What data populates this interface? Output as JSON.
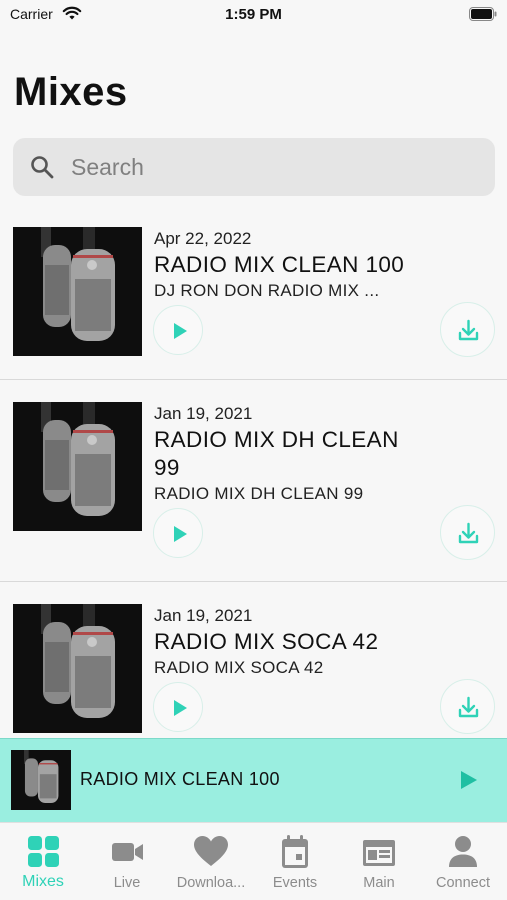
{
  "status_bar": {
    "carrier": "Carrier",
    "time": "1:59 PM"
  },
  "page": {
    "title": "Mixes"
  },
  "search": {
    "placeholder": "Search"
  },
  "mixes": [
    {
      "date": "Apr 22, 2022",
      "title": "RADIO MIX CLEAN 100",
      "artist": "DJ  RON DON RADIO MIX ..."
    },
    {
      "date": "Jan 19, 2021",
      "title": "RADIO MIX DH CLEAN 99",
      "artist": "RADIO MIX DH CLEAN 99"
    },
    {
      "date": "Jan 19, 2021",
      "title": "RADIO MIX SOCA 42",
      "artist": "RADIO MIX SOCA 42"
    }
  ],
  "player": {
    "now_playing": "RADIO MIX CLEAN 100"
  },
  "tabs": [
    {
      "label": "Mixes",
      "icon": "grid-icon",
      "active": true
    },
    {
      "label": "Live",
      "icon": "video-camera-icon"
    },
    {
      "label": "Downloa...",
      "icon": "heart-icon"
    },
    {
      "label": "Events",
      "icon": "calendar-icon"
    },
    {
      "label": "Main",
      "icon": "browser-window-icon"
    },
    {
      "label": "Connect",
      "icon": "person-icon"
    }
  ],
  "colors": {
    "accent": "#2fd2b7",
    "player_bg": "#9aeee0",
    "inactive_tab": "#8c8c8c",
    "search_bg": "#e5e5e5"
  }
}
